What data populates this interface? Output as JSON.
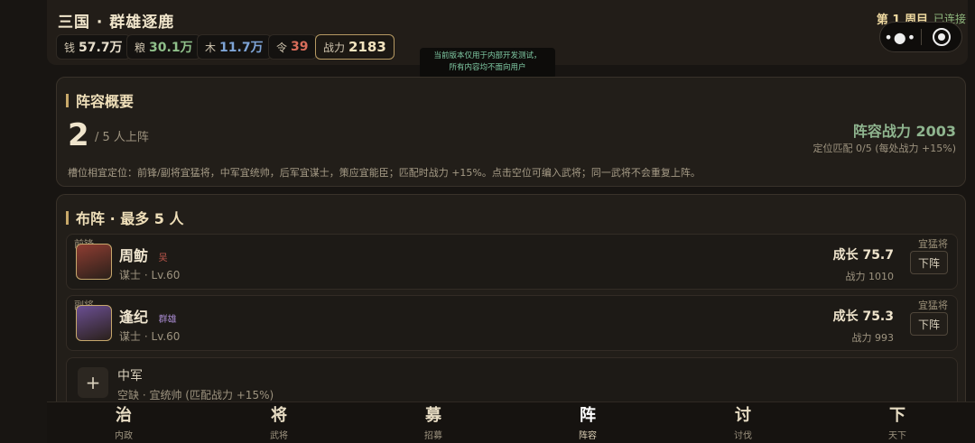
{
  "header": {
    "title": "三国 · 群雄逐鹿",
    "resources": [
      {
        "label": "钱",
        "value": "57.7万",
        "color": "#e8dfcc"
      },
      {
        "label": "粮",
        "value": "30.1万",
        "color": "#8fbf8a"
      },
      {
        "label": "木",
        "value": "11.7万",
        "color": "#7ea4d6"
      },
      {
        "label": "令",
        "value": "39",
        "color": "#d96d5a"
      }
    ],
    "power_label": "战力",
    "power_value": "2183",
    "round": "第 1 周目",
    "connection": "已连接",
    "capsule_more_icon": "more-dots-icon",
    "capsule_close_icon": "target-icon"
  },
  "notice": {
    "line1": "当前版本仅用于内部开发测试，",
    "line2": "所有内容均不面向用户"
  },
  "summary": {
    "title": "阵容概要",
    "count": "2",
    "count_suffix": "/ 5 人上阵",
    "lineup_power": "阵容战力 2003",
    "match_info": "定位匹配 0/5 (每处战力 +15%)",
    "hint": "槽位相宜定位：前锋/副将宜猛将，中军宜统帅，后军宜谋士，策应宜能臣；匹配时战力 +15%。点击空位可编入武将；同一武将不会重复上阵。"
  },
  "lineup": {
    "title": "布阵 · 最多 5 人",
    "slots": [
      {
        "slot": "前锋",
        "name": "周鲂",
        "faction": "吴",
        "faction_color": "#c0584d",
        "meta": "谋士 · Lv.60",
        "growth": "成长 75.7",
        "power": "战力 1010",
        "fit": "宜猛将",
        "remove_label": "下阵",
        "avatar_color": "#8e3d32"
      },
      {
        "slot": "副将",
        "name": "逢纪",
        "faction": "群雄",
        "faction_color": "#a98bd1",
        "meta": "谋士 · Lv.60",
        "growth": "成长 75.3",
        "power": "战力 993",
        "fit": "宜猛将",
        "remove_label": "下阵",
        "avatar_color": "#6b4f93"
      }
    ],
    "empty": {
      "name": "中军",
      "meta": "空缺 · 宜统帅 (匹配战力 +15%)",
      "plus": "+"
    }
  },
  "tabs": [
    {
      "glyph": "治",
      "label": "内政"
    },
    {
      "glyph": "将",
      "label": "武将"
    },
    {
      "glyph": "募",
      "label": "招募"
    },
    {
      "glyph": "阵",
      "label": "阵容",
      "active": true
    },
    {
      "glyph": "讨",
      "label": "讨伐"
    },
    {
      "glyph": "下",
      "label": "天下"
    }
  ]
}
